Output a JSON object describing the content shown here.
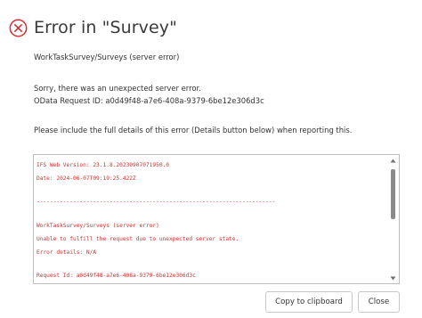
{
  "dialog": {
    "title": "Error in \"Survey\"",
    "icon": "error-circle-x-icon",
    "icon_color": "#d32f2f",
    "message_lines": [
      "WorkTaskSurvey/Surveys (server error)",
      "Sorry, there was an unexpected server error.",
      "OData Request ID: a0d49f48-a7e6-408a-9379-6be12e306d3c",
      "Please include the full details of this error (Details button below) when reporting this."
    ]
  },
  "details": {
    "text_color": "#d32f2f",
    "lines": [
      "IFS Web Version: 23.1.8.20230907071950.0",
      "Date: 2024-06-07T09:19:25.422Z",
      "------------------------------------------------------------------------",
      "WorkTaskSurvey/Surveys (server error)",
      "Unable to fulfill the request due to unexpected server state.",
      "Error details: N/A",
      "Request Id: a0d49f48-a7e6-408a-9379-6be12e306d3c"
    ]
  },
  "buttons": {
    "copy_label": "Copy to clipboard",
    "close_label": "Close"
  }
}
